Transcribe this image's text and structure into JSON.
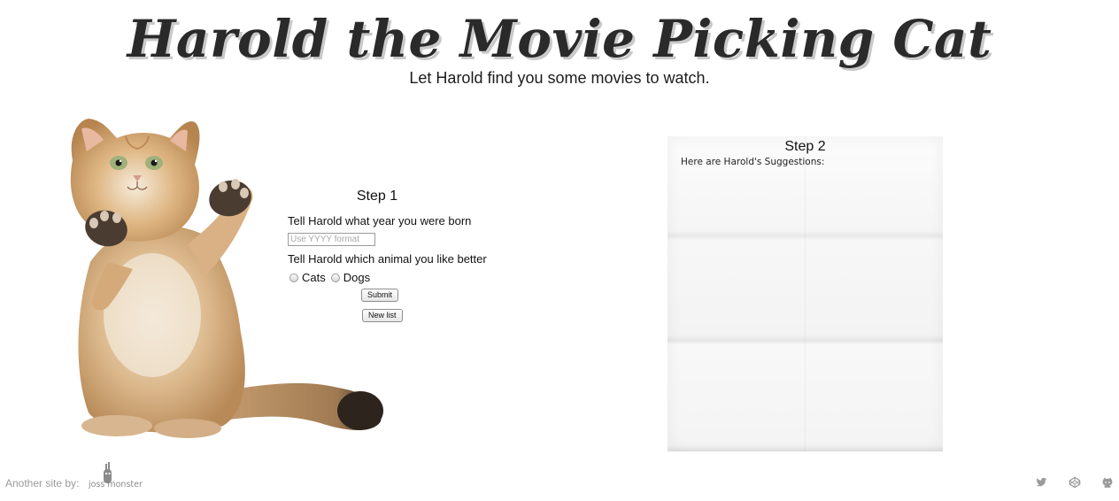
{
  "header": {
    "title": "Harold the Movie Picking Cat",
    "subtitle": "Let Harold find you some movies to watch."
  },
  "step1": {
    "title": "Step 1",
    "year_question": "Tell Harold what year you were born",
    "year_input": {
      "value": "",
      "placeholder": "Use YYYY format"
    },
    "animal_question": "Tell Harold which animal you like better",
    "animal_options": [
      {
        "label": "Cats",
        "selected": false
      },
      {
        "label": "Dogs",
        "selected": false
      }
    ],
    "submit_label": "Submit",
    "new_list_label": "New list"
  },
  "step2": {
    "title": "Step 2",
    "suggestions_label": "Here are Harold's Suggestions:"
  },
  "footer": {
    "credit_text": "Another site by:",
    "logo_text": "joss monster",
    "social_icons": [
      "twitter-icon",
      "codepen-icon",
      "github-icon"
    ],
    "icon_color": "#9a9a9a"
  },
  "colors": {
    "title": "#2a2a2a",
    "title_shadow": "#c9c9c9",
    "footer_text": "#9a9a9a"
  }
}
